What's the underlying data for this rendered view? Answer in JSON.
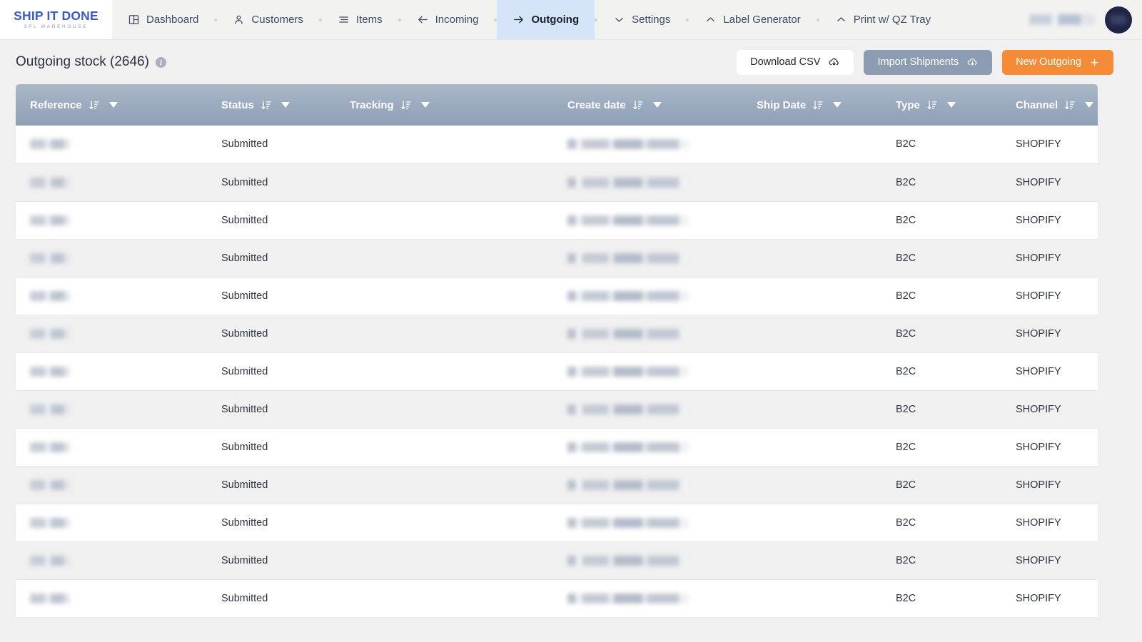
{
  "brand": {
    "name": "SHIP IT DONE",
    "tagline": "3PL WAREHOUSE"
  },
  "nav": {
    "items": [
      {
        "label": "Dashboard",
        "icon": "dashboard-icon",
        "active": false
      },
      {
        "label": "Customers",
        "icon": "user-icon",
        "active": false
      },
      {
        "label": "Items",
        "icon": "list-icon",
        "active": false
      },
      {
        "label": "Incoming",
        "icon": "arrow-left-icon",
        "active": false
      },
      {
        "label": "Outgoing",
        "icon": "arrow-right-icon",
        "active": true
      },
      {
        "label": "Settings",
        "icon": "chevron-down-icon",
        "active": false
      },
      {
        "label": "Label Generator",
        "icon": "chevron-up-icon",
        "active": false
      },
      {
        "label": "Print w/ QZ Tray",
        "icon": "chevron-up-icon",
        "active": false
      }
    ],
    "user_name_redacted": true,
    "avatar_label": "user-avatar"
  },
  "page": {
    "title": "Outgoing stock (2646)",
    "count": 2646,
    "info_glyph": "i"
  },
  "toolbar": {
    "download_csv": "Download CSV",
    "import_shipments": "Import Shipments",
    "new_outgoing": "New Outgoing",
    "accent_orange": "#f68b37",
    "slate": "#8c9cb2"
  },
  "table": {
    "columns": [
      {
        "label": "Reference",
        "key": "reference"
      },
      {
        "label": "Status",
        "key": "status"
      },
      {
        "label": "Tracking",
        "key": "tracking"
      },
      {
        "label": "Create date",
        "key": "create_date"
      },
      {
        "label": "Ship Date",
        "key": "ship_date"
      },
      {
        "label": "Type",
        "key": "type"
      },
      {
        "label": "Channel",
        "key": "channel"
      }
    ],
    "rows": [
      {
        "reference": "",
        "status": "Submitted",
        "tracking": "",
        "create_date": "",
        "ship_date": "",
        "type": "B2C",
        "channel": "SHOPIFY"
      },
      {
        "reference": "",
        "status": "Submitted",
        "tracking": "",
        "create_date": "",
        "ship_date": "",
        "type": "B2C",
        "channel": "SHOPIFY"
      },
      {
        "reference": "",
        "status": "Submitted",
        "tracking": "",
        "create_date": "",
        "ship_date": "",
        "type": "B2C",
        "channel": "SHOPIFY"
      },
      {
        "reference": "",
        "status": "Submitted",
        "tracking": "",
        "create_date": "",
        "ship_date": "",
        "type": "B2C",
        "channel": "SHOPIFY"
      },
      {
        "reference": "",
        "status": "Submitted",
        "tracking": "",
        "create_date": "",
        "ship_date": "",
        "type": "B2C",
        "channel": "SHOPIFY"
      },
      {
        "reference": "",
        "status": "Submitted",
        "tracking": "",
        "create_date": "",
        "ship_date": "",
        "type": "B2C",
        "channel": "SHOPIFY"
      },
      {
        "reference": "",
        "status": "Submitted",
        "tracking": "",
        "create_date": "",
        "ship_date": "",
        "type": "B2C",
        "channel": "SHOPIFY"
      },
      {
        "reference": "",
        "status": "Submitted",
        "tracking": "",
        "create_date": "",
        "ship_date": "",
        "type": "B2C",
        "channel": "SHOPIFY"
      },
      {
        "reference": "",
        "status": "Submitted",
        "tracking": "",
        "create_date": "",
        "ship_date": "",
        "type": "B2C",
        "channel": "SHOPIFY"
      },
      {
        "reference": "",
        "status": "Submitted",
        "tracking": "",
        "create_date": "",
        "ship_date": "",
        "type": "B2C",
        "channel": "SHOPIFY"
      },
      {
        "reference": "",
        "status": "Submitted",
        "tracking": "",
        "create_date": "",
        "ship_date": "",
        "type": "B2C",
        "channel": "SHOPIFY"
      },
      {
        "reference": "",
        "status": "Submitted",
        "tracking": "",
        "create_date": "",
        "ship_date": "",
        "type": "B2C",
        "channel": "SHOPIFY"
      },
      {
        "reference": "",
        "status": "Submitted",
        "tracking": "",
        "create_date": "",
        "ship_date": "",
        "type": "B2C",
        "channel": "SHOPIFY"
      }
    ]
  }
}
